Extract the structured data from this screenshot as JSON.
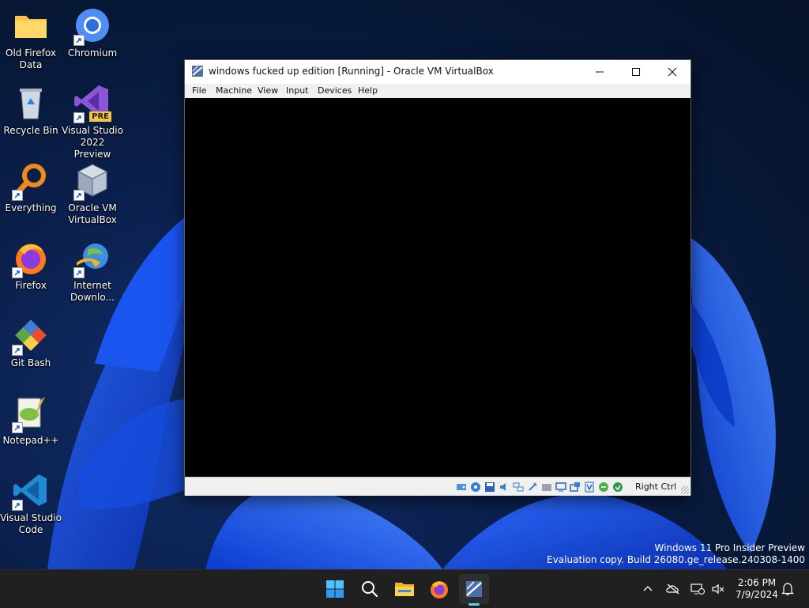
{
  "desktop": {
    "icons": [
      {
        "label": "Old Firefox Data"
      },
      {
        "label": "Chromium"
      },
      {
        "label": "Recycle Bin"
      },
      {
        "label": "Visual Studio 2022 Preview"
      },
      {
        "label": "Everything"
      },
      {
        "label": "Oracle VM VirtualBox"
      },
      {
        "label": "Firefox"
      },
      {
        "label": "Internet Downlo..."
      },
      {
        "label": "Git Bash"
      },
      {
        "label": "Notepad++"
      },
      {
        "label": "Visual Studio Code"
      }
    ],
    "vs_badge": "PRE"
  },
  "window": {
    "title": "windows fucked up edition [Running] - Oracle VM VirtualBox",
    "menu": [
      "File",
      "Machine",
      "View",
      "Input",
      "Devices",
      "Help"
    ],
    "host_key": "Right Ctrl",
    "status_icons": [
      "hard-disk-icon",
      "optical-drive-icon",
      "floppy-icon",
      "audio-icon",
      "network-icon",
      "usb-icon",
      "shared-folder-icon",
      "display-icon",
      "recording-icon",
      "vbox-extension-icon",
      "mouse-integration-icon",
      "keyboard-icon"
    ]
  },
  "watermark": {
    "line1": "Windows 11 Pro Insider Preview",
    "line2": "Evaluation copy. Build 26080.ge_release.240308-1400"
  },
  "taskbar": {
    "time": "2:06 PM",
    "date": "7/9/2024",
    "apps": [
      "start-icon",
      "search-icon",
      "file-explorer-icon",
      "firefox-icon",
      "virtualbox-vm-icon"
    ],
    "accent": "#0078d4"
  }
}
